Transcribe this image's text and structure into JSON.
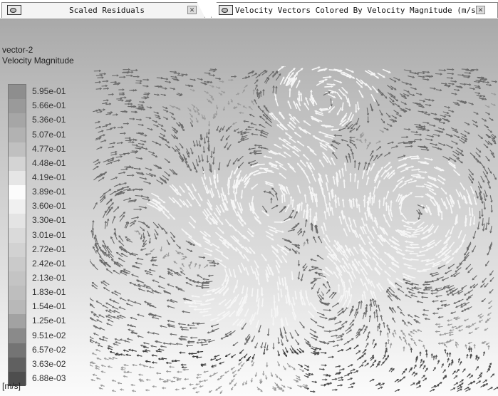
{
  "tabs": [
    {
      "label": "Scaled Residuals",
      "close_icon": "close-icon",
      "icon": "graphics-window-icon"
    },
    {
      "label": "Velocity Vectors Colored By Velocity Magnitude (m/s)",
      "close_icon": "close-icon",
      "icon": "graphics-window-icon"
    }
  ],
  "legend": {
    "title": "vector-2",
    "quantity": "Velocity Magnitude",
    "unit": "[m/s]",
    "ticks": [
      "5.95e-01",
      "5.66e-01",
      "5.36e-01",
      "5.07e-01",
      "4.77e-01",
      "4.48e-01",
      "4.19e-01",
      "3.89e-01",
      "3.60e-01",
      "3.30e-01",
      "3.01e-01",
      "2.72e-01",
      "2.42e-01",
      "2.13e-01",
      "1.83e-01",
      "1.54e-01",
      "1.25e-01",
      "9.51e-02",
      "6.57e-02",
      "3.63e-02",
      "6.88e-03"
    ],
    "colors": [
      "#8e8e8e",
      "#9a9a9a",
      "#a6a6a6",
      "#b2b2b2",
      "#c0c0c0",
      "#d4d4d4",
      "#e6e6e6",
      "#fcfcfc",
      "#f0f0f0",
      "#e4e4e4",
      "#dadada",
      "#d2d2d2",
      "#cacaca",
      "#c4c4c4",
      "#bebebe",
      "#b8b8b8",
      "#a2a2a2",
      "#8a8a8a",
      "#747474",
      "#606060",
      "#4e4e4e"
    ]
  },
  "colors": {
    "viewport_top": "#a9a9a9",
    "viewport_bottom": "#fbfbfb",
    "vector_fast": "#f6f6f6",
    "vector_mid": "#9a9a9a",
    "vector_slow": "#3a3a3a"
  }
}
